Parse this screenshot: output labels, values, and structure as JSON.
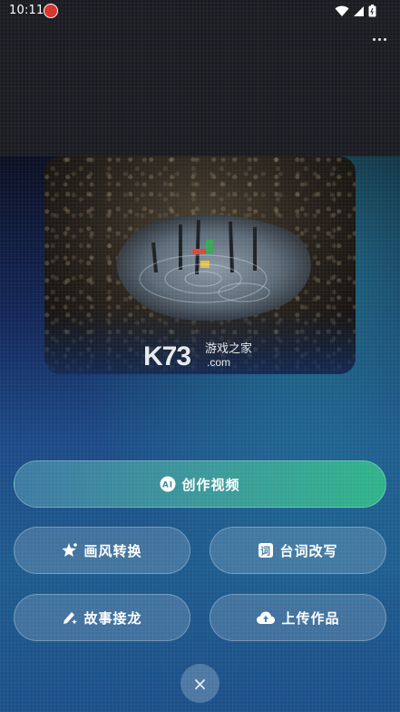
{
  "status_bar": {
    "time": "10:11",
    "app_icon": "app-notification-icon",
    "icons": [
      "wifi-icon",
      "cellular-signal-icon",
      "battery-icon"
    ]
  },
  "top_bar": {
    "more_icon": "more-horizontal-icon"
  },
  "preview": {
    "image": "puddle-reflection-photo"
  },
  "watermark": {
    "brand": "K73",
    "name": "游戏之家",
    "domain": ".com"
  },
  "actions": {
    "create_video": {
      "label": "创作视频",
      "icon": "ai-badge-icon",
      "icon_text": "AI"
    },
    "style_transfer": {
      "label": "画风转换",
      "icon": "sparkle-star-icon"
    },
    "line_rewrite": {
      "label": "台词改写",
      "icon": "word-card-icon",
      "icon_text": "词"
    },
    "story_chain": {
      "label": "故事接龙",
      "icon": "pen-sparkle-icon"
    },
    "upload_works": {
      "label": "上传作品",
      "icon": "cloud-upload-icon"
    }
  },
  "close": {
    "label": "×",
    "icon": "close-icon"
  },
  "colors": {
    "primary_gradient_start": "#3d7aa3",
    "primary_gradient_end": "#2fb38a",
    "background_dark": "#0b0f22",
    "background_blue": "#1c4a86"
  }
}
